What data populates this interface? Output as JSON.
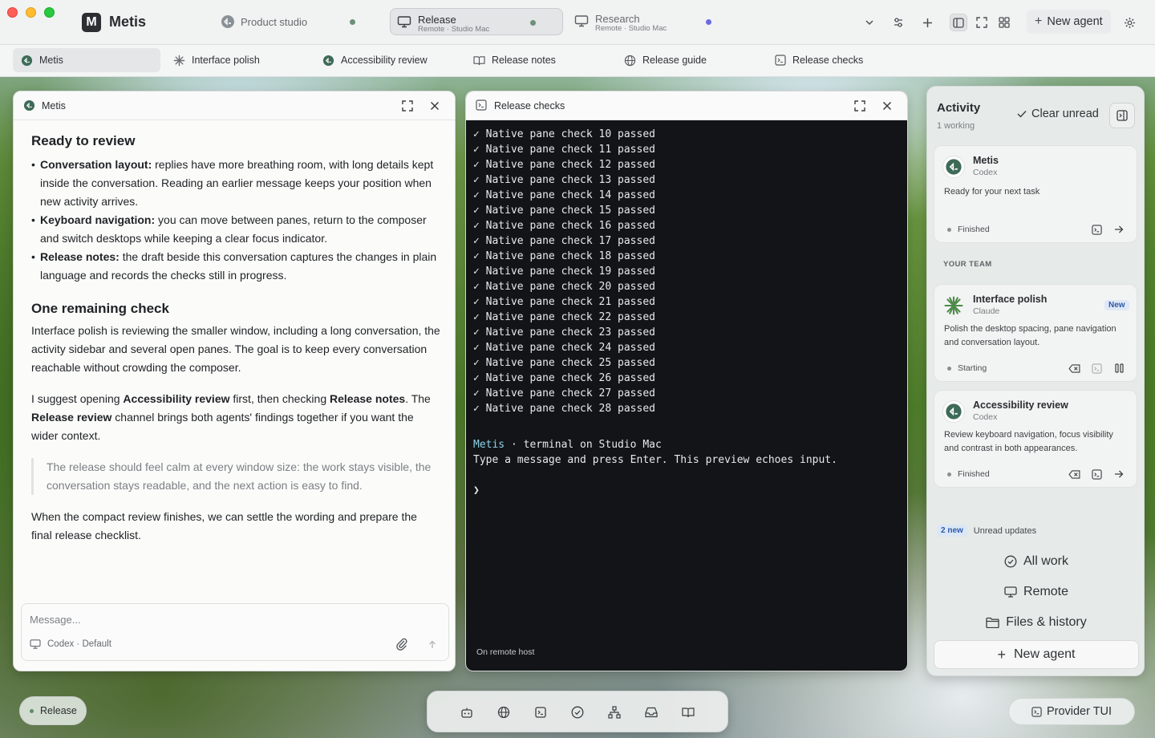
{
  "app": {
    "name": "Metis",
    "logo_letter": "M"
  },
  "desktops": [
    {
      "title": "Product studio",
      "subtitle": "",
      "dot_color": "#6d8f78"
    },
    {
      "title": "Release",
      "subtitle": "Remote · Studio Mac",
      "dot_color": "#6d8f78"
    },
    {
      "title": "Research",
      "subtitle": "Remote · Studio Mac",
      "dot_color": "#6b6be0"
    }
  ],
  "toolbar": {
    "new_agent": "New agent"
  },
  "pane_tabs": [
    "Metis",
    "Interface polish",
    "Accessibility review",
    "Release notes",
    "Release guide",
    "Release checks"
  ],
  "chat": {
    "title": "Metis",
    "h1": "Ready to review",
    "bullets": [
      {
        "bold": "Conversation layout:",
        "text": " replies have more breathing room, with long details kept inside the conversation. Reading an earlier message keeps your position when new activity arrives."
      },
      {
        "bold": "Keyboard navigation:",
        "text": " you can move between panes, return to the composer and switch desktops while keeping a clear focus indicator."
      },
      {
        "bold": "Release notes:",
        "text": " the draft beside this conversation captures the changes in plain language and records the checks still in progress."
      }
    ],
    "h2": "One remaining check",
    "p1": "Interface polish is reviewing the smaller window, including a long conversation, the activity sidebar and several open panes. The goal is to keep every conversation reachable without crowding the composer.",
    "p2_a": "I suggest opening ",
    "p2_b": "Accessibility review",
    "p2_c": " first, then checking ",
    "p2_d": "Release notes",
    "p2_e": ". The ",
    "p2_f": "Release review",
    "p2_g": " channel brings both agents' findings together if you want the wider context.",
    "quote": "The release should feel calm at every window size: the work stays visible, the conversation stays readable, and the next action is easy to find.",
    "p3": "When the compact review finishes, we can settle the wording and prepare the final release checklist.",
    "composer_placeholder": "Message...",
    "composer_meta": "Codex · Default"
  },
  "terminal": {
    "title": "Release checks",
    "lines": [
      "✓ Native pane check 10 passed",
      "✓ Native pane check 11 passed",
      "✓ Native pane check 12 passed",
      "✓ Native pane check 13 passed",
      "✓ Native pane check 14 passed",
      "✓ Native pane check 15 passed",
      "✓ Native pane check 16 passed",
      "✓ Native pane check 17 passed",
      "✓ Native pane check 18 passed",
      "✓ Native pane check 19 passed",
      "✓ Native pane check 20 passed",
      "✓ Native pane check 21 passed",
      "✓ Native pane check 22 passed",
      "✓ Native pane check 23 passed",
      "✓ Native pane check 24 passed",
      "✓ Native pane check 25 passed",
      "✓ Native pane check 26 passed",
      "✓ Native pane check 27 passed",
      "✓ Native pane check 28 passed"
    ],
    "prompt_user": "Metis",
    "prompt_rest": " · terminal on Studio Mac",
    "info": "Type a message and press Enter. This preview echoes input.",
    "caret": "❯",
    "footer": "On remote host"
  },
  "activity": {
    "title": "Activity",
    "subtitle": "1 working",
    "clear_unread": "Clear unread",
    "current": {
      "name": "Metis",
      "provider": "Codex",
      "desc": "Ready for your next task",
      "status": "Finished"
    },
    "team_label": "YOUR TEAM",
    "team": [
      {
        "name": "Interface polish",
        "provider": "Claude",
        "badge": "New",
        "desc": "Polish the desktop spacing, pane navigation and conversation layout.",
        "status": "Starting"
      },
      {
        "name": "Accessibility review",
        "provider": "Codex",
        "desc": "Review keyboard navigation, focus visibility and contrast in both appearances.",
        "status": "Finished"
      }
    ],
    "unread_count": "2 new",
    "unread_label": "Unread updates",
    "links": [
      "All work",
      "Remote",
      "Files & history"
    ],
    "new_agent": "New agent"
  },
  "bottom": {
    "desktop_pill": "Release",
    "provider_tui": "Provider TUI",
    "dock_icons": [
      "agent-icon",
      "globe-icon",
      "terminal-icon",
      "check-circle-icon",
      "org-tree-icon",
      "inbox-icon",
      "book-icon"
    ]
  }
}
